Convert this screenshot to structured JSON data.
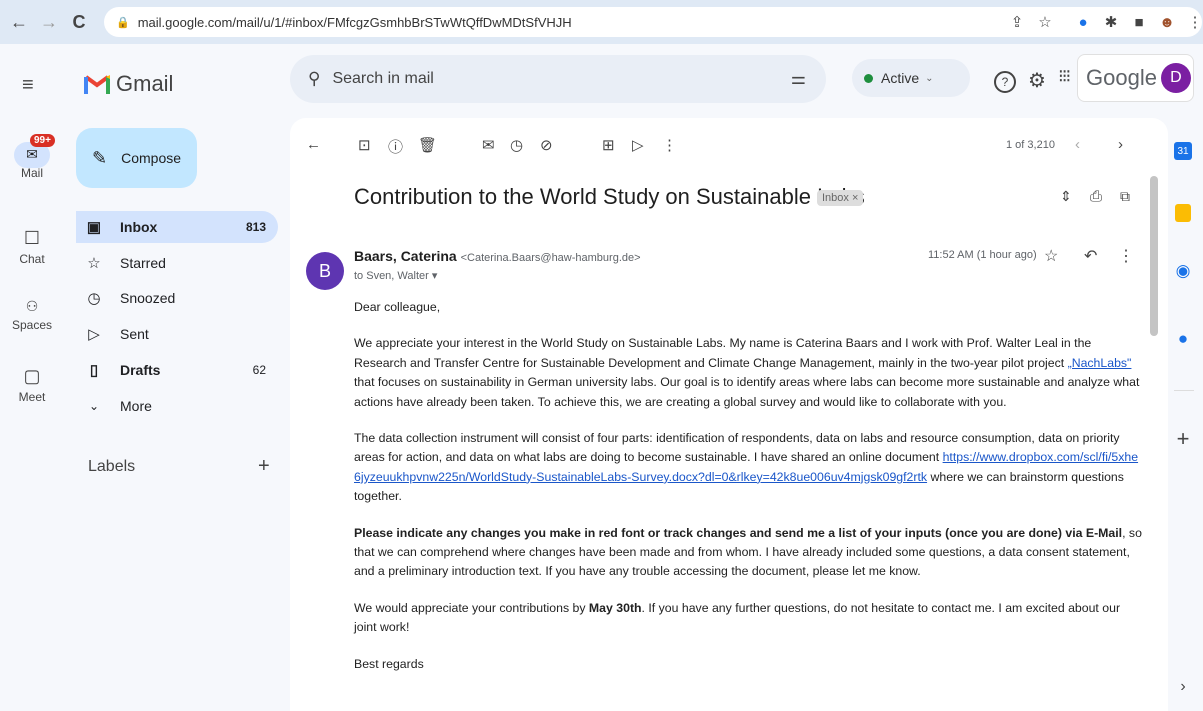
{
  "browser": {
    "url": "mail.google.com/mail/u/1/#inbox/FMfcgzGsmhbBrSTwWtQffDwMDtSfVHJH"
  },
  "app": {
    "name": "Gmail",
    "search_placeholder": "Search in mail",
    "status": "Active",
    "google_label": "Google",
    "account_initial": "D"
  },
  "rail": {
    "badge": "99+",
    "items": [
      {
        "label": "Mail"
      },
      {
        "label": "Chat"
      },
      {
        "label": "Spaces"
      },
      {
        "label": "Meet"
      }
    ]
  },
  "nav": {
    "compose": "Compose",
    "items": [
      {
        "label": "Inbox",
        "count": "813",
        "bold": true
      },
      {
        "label": "Starred",
        "count": ""
      },
      {
        "label": "Snoozed",
        "count": ""
      },
      {
        "label": "Sent",
        "count": ""
      },
      {
        "label": "Drafts",
        "count": "62",
        "bold": true
      },
      {
        "label": "More",
        "count": ""
      }
    ],
    "labels_heading": "Labels"
  },
  "toolbar": {
    "pagination": "1 of 3,210"
  },
  "email": {
    "subject": "Contribution to the World Study on Sustainable Labs",
    "chip": "Inbox ×",
    "sender_initial": "B",
    "sender_name": "Baars, Caterina",
    "sender_email": "<Caterina.Baars@haw-hamburg.de>",
    "to": "to Sven, Walter ▾",
    "time": "11:52 AM (1 hour ago)",
    "greeting": "Dear colleague,",
    "p1_a": "We appreciate your interest in the World Study on Sustainable Labs. My name is Caterina Baars and I work with Prof. Walter Leal in the Research and Transfer Centre for Sustainable Development and Climate Change Management, mainly in the two-year pilot project ",
    "p1_link": "„NachLabs\"",
    "p1_b": " that focuses on sustainability in German university labs. Our goal is to identify areas where labs can become more sustainable and analyze what actions have already been taken. To achieve this, we are creating a global survey and would like to collaborate with you.",
    "p2_a": "The data collection instrument will consist of four parts: identification of respondents, data on labs and resource consumption, data on priority areas for action, and data on what labs are doing to become sustainable. I have shared an online document ",
    "p2_link": "https://www.dropbox.com/scl/fi/5xhe6jyzeuukhpvnw225n/WorldStudy-SustainableLabs-Survey.docx?dl=0&rlkey=42k8ue006uv4mjgsk09gf2rtk",
    "p2_b": " where we can brainstorm questions together.",
    "p3_bold": "Please indicate any changes you make in red font or track changes and send me a list of your inputs (once you are done) via E-Mail",
    "p3_rest": ", so that we can comprehend where changes have been made and from whom. I have already included some questions, a data consent statement, and a preliminary introduction text. If you have any trouble accessing the document, please let me know.",
    "p4_a": "We would appreciate your contributions by ",
    "p4_bold": "May 30th",
    "p4_b": ". If you have any further questions, do not hesitate to contact me. I am excited about our joint work!",
    "closing": "Best regards"
  },
  "colors": {
    "compose_bg": "#c2e7ff",
    "inbox_selected_bg": "#d3e3fd",
    "sender_avatar": "#5e35b1",
    "account_avatar": "#7b1fa2"
  }
}
